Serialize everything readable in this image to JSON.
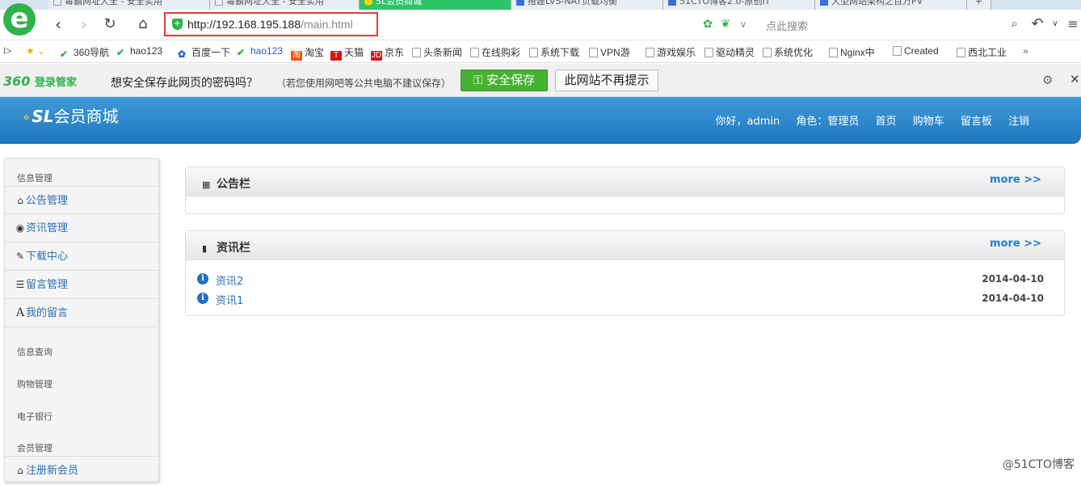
{
  "tabs": [
    {
      "label": "毒霸网址大全 - 安全实用"
    },
    {
      "label": "毒霸网址大全 - 安全实用"
    },
    {
      "label": "SL会员商城"
    },
    {
      "label": "搭建LVS-NAT负载均衡"
    },
    {
      "label": "51CTO博客2.0-原创IT"
    },
    {
      "label": "大型网站架构之百万PV"
    }
  ],
  "browser": {
    "url_host": "http://192.168.195.188",
    "url_path": "/main.html",
    "search_placeholder": "点此搜索"
  },
  "bookmarks": [
    {
      "label": "360导航"
    },
    {
      "label": "hao123"
    },
    {
      "label": "百度一下"
    },
    {
      "label": "hao123"
    },
    {
      "label": "淘宝"
    },
    {
      "label": "天猫"
    },
    {
      "label": "京东"
    },
    {
      "label": "头条新闻"
    },
    {
      "label": "在线购彩"
    },
    {
      "label": "系统下载"
    },
    {
      "label": "VPN游"
    },
    {
      "label": "游戏娱乐"
    },
    {
      "label": "驱动精灵"
    },
    {
      "label": "系统优化"
    },
    {
      "label": "Nginx中"
    },
    {
      "label": "Created"
    },
    {
      "label": "西北工业"
    }
  ],
  "password_bar": {
    "brand": "360",
    "brand_sub": "登录管家",
    "question": "想安全保存此网页的密码吗？",
    "note": "（若您使用网吧等公共电脑不建议保存）",
    "save_label": "安全保存",
    "never_label": "此网站不再提示"
  },
  "site": {
    "logo_sl": "SL",
    "logo_text": "会员商城",
    "greeting": "你好，admin",
    "role": "角色：管理员",
    "nav": [
      "首页",
      "购物车",
      "留言板",
      "注销"
    ]
  },
  "sidebar": {
    "sections": [
      {
        "head": "信息管理"
      },
      {
        "head": "信息查询"
      },
      {
        "head": "购物管理"
      },
      {
        "head": "电子银行"
      },
      {
        "head": "会员管理"
      }
    ],
    "items": [
      {
        "label": "公告管理",
        "icon": "home-icon"
      },
      {
        "label": "资讯管理",
        "icon": "eye-icon"
      },
      {
        "label": "下载中心",
        "icon": "edit-icon"
      },
      {
        "label": "留言管理",
        "icon": "list-icon"
      },
      {
        "label": "我的留言",
        "icon": "font-icon"
      },
      {
        "label": "注册新会员",
        "icon": "home-icon"
      }
    ]
  },
  "panels": {
    "notice": {
      "title": "公告栏",
      "more": "more >>"
    },
    "news": {
      "title": "资讯栏",
      "more": "more >>",
      "rows": [
        {
          "title": "资讯2",
          "date": "2014-04-10"
        },
        {
          "title": "资讯1",
          "date": "2014-04-10"
        }
      ]
    }
  },
  "watermark": "@51CTO博客"
}
